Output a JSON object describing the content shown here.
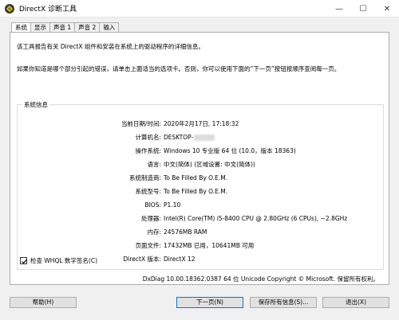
{
  "window": {
    "title": "DirectX 诊断工具",
    "controls": {
      "minimize": "—",
      "maximize": "☐",
      "close": "✕"
    }
  },
  "tabs": [
    {
      "label": "系统",
      "active": true
    },
    {
      "label": "显示",
      "active": false
    },
    {
      "label": "声音 1",
      "active": false
    },
    {
      "label": "声音 2",
      "active": false
    },
    {
      "label": "输入",
      "active": false
    }
  ],
  "intro": {
    "line1": "该工具报告有关 DirectX 组件和安装在系统上的驱动程序的详细信息。",
    "line2": "如果你知道是哪个部分引起的错误，请单击上面适当的选项卡。否则，你可以使用下面的“下一页”按钮按顺序查阅每一页。"
  },
  "system_info": {
    "title": "系统信息",
    "rows": [
      {
        "label": "当前日期/时间:",
        "value": "2020年2月17日, 17:18:32"
      },
      {
        "label": "计算机名:",
        "value": "DESKTOP-"
      },
      {
        "label": "操作系统:",
        "value": "Windows 10 专业版 64 位 (10.0，版本 18363)"
      },
      {
        "label": "语言:",
        "value": "中文(简体) (区域设置: 中文(简体))"
      },
      {
        "label": "系统制造商:",
        "value": "To Be Filled By O.E.M."
      },
      {
        "label": "系统型号:",
        "value": "To Be Filled By O.E.M."
      },
      {
        "label": "BIOS:",
        "value": "P1.10"
      },
      {
        "label": "处理器:",
        "value": "Intel(R) Core(TM) i5-8400 CPU @ 2.80GHz (6 CPUs), ~2.8GHz"
      },
      {
        "label": "内存:",
        "value": "24576MB RAM"
      },
      {
        "label": "页面文件:",
        "value": "17432MB 已用，10641MB 可用"
      },
      {
        "label": "DirectX 版本:",
        "value": "DirectX 12"
      }
    ]
  },
  "whql_checkbox": {
    "label": "检查 WHQL 数字签名(C)",
    "checked": true
  },
  "footer_text": "DxDiag 10.00.18362.0387 64 位 Unicode  Copyright © Microsoft. 保留所有权利。",
  "buttons": {
    "help": "帮助(H)",
    "next": "下一页(N)",
    "save": "保存所有信息(S)...",
    "exit": "退出(X)"
  },
  "colors": {
    "accent": "#0078d7",
    "panel": "#ffffff",
    "background": "#f0f0f0"
  }
}
